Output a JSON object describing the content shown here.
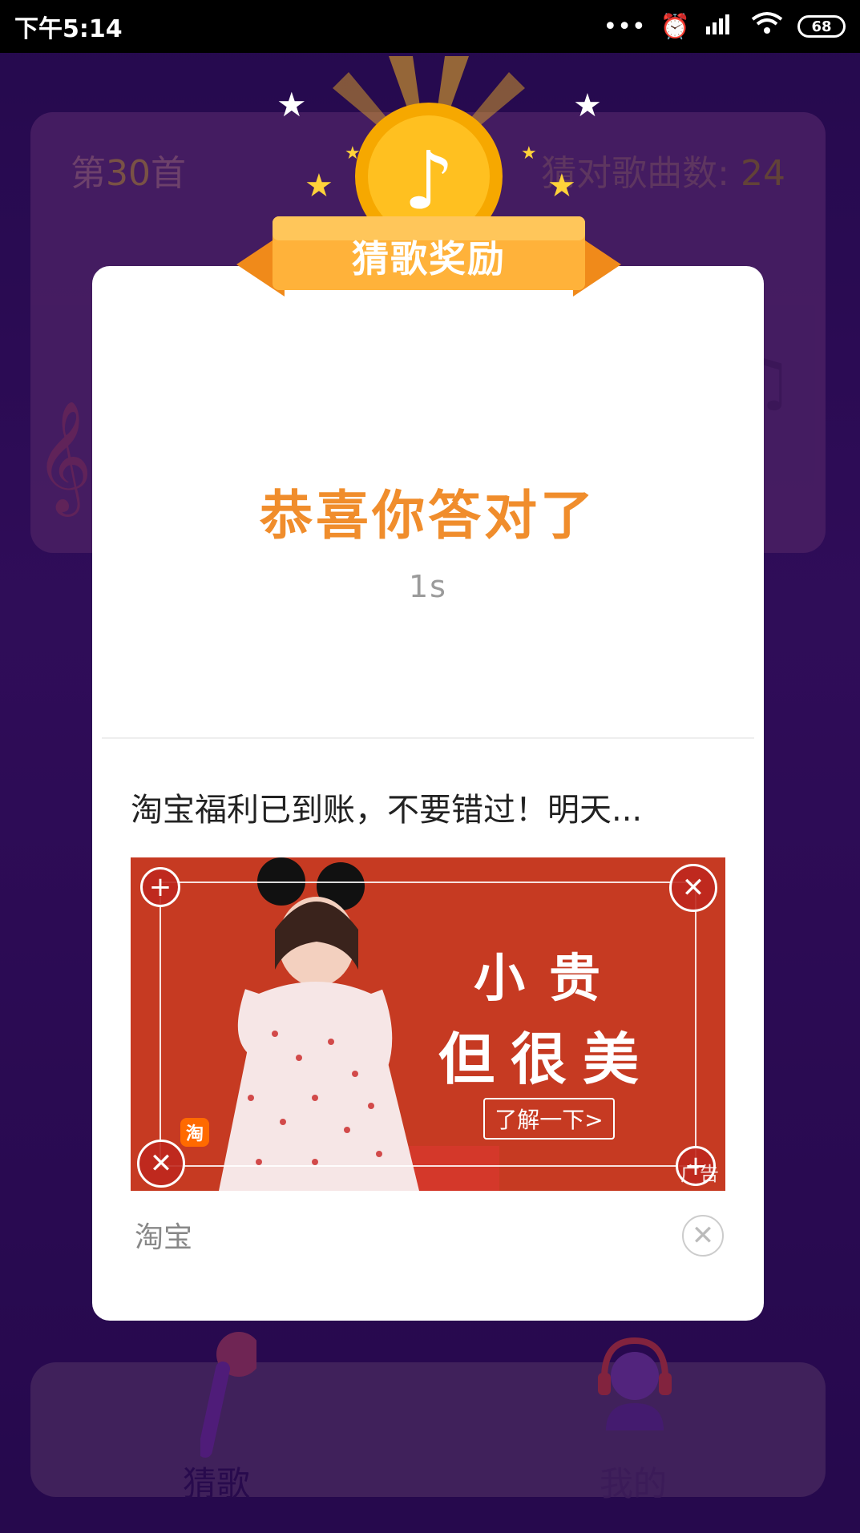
{
  "status_bar": {
    "time": "下午5:14",
    "dots": "•••",
    "alarm_icon": "alarm-icon",
    "signal_icon": "signal-icon",
    "wifi_icon": "wifi-icon",
    "battery_level": "68"
  },
  "game_card": {
    "prefix": "第",
    "song_number": "30",
    "suffix": "首",
    "correct_label": "猜对歌曲数: ",
    "correct_count": "24"
  },
  "modal": {
    "banner_title": "猜歌奖励",
    "congrats": "恭喜你答对了",
    "countdown": "1s"
  },
  "ad": {
    "title": "淘宝福利已到账，不要错过！明天...",
    "line1": "小贵",
    "line2": "但很美",
    "cta": "了解一下>",
    "badge": "淘",
    "mark": "广告",
    "source": "淘宝"
  },
  "nav": {
    "guess_label": "猜歌",
    "mine_label": "我的"
  },
  "colors": {
    "accent_orange": "#f08d2c",
    "ad_red": "#c33a1f",
    "bg_purple": "#2a0f57"
  }
}
